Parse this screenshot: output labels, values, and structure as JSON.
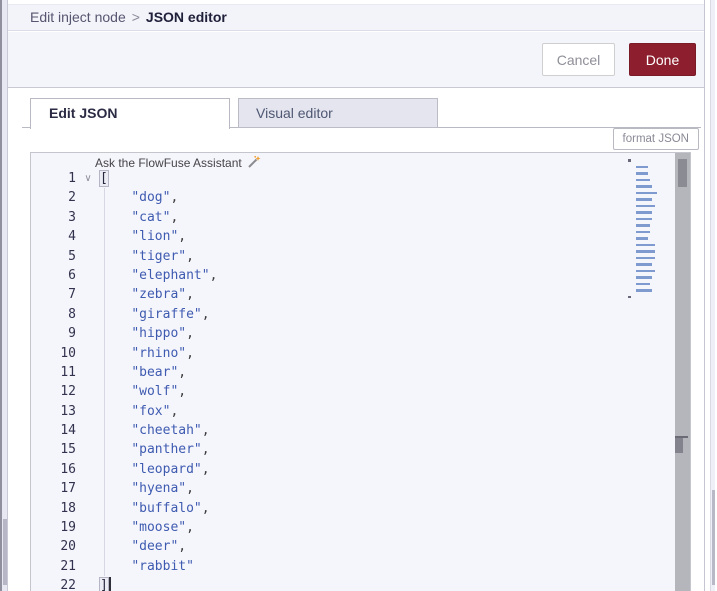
{
  "breadcrumb": {
    "parent": "Edit inject node",
    "separator": ">",
    "current": "JSON editor"
  },
  "buttons": {
    "cancel": "Cancel",
    "done": "Done",
    "format_json": "format JSON"
  },
  "tabs": [
    {
      "label": "Edit JSON",
      "active": true
    },
    {
      "label": "Visual editor",
      "active": false
    }
  ],
  "assistant": {
    "label": "Ask the FlowFuse Assistant",
    "icon": "pencil-sparkle-icon"
  },
  "editor": {
    "language": "json",
    "open_bracket": "[",
    "close_bracket": "]",
    "indent": "    ",
    "items": [
      "dog",
      "cat",
      "lion",
      "tiger",
      "elephant",
      "zebra",
      "giraffe",
      "hippo",
      "rhino",
      "bear",
      "wolf",
      "fox",
      "cheetah",
      "panther",
      "leopard",
      "hyena",
      "buffalo",
      "moose",
      "deer",
      "rabbit"
    ],
    "first_line_number": 1,
    "last_line_number": 22,
    "cursor_line": 22,
    "fold_icon": "chevron-down-icon"
  },
  "colors": {
    "done_button": "#8C1E2D",
    "string_token": "#3E5BB0",
    "line_number": "#32324E",
    "editor_background": "#F5F5FC",
    "inactive_tab_background": "#E5E5F0",
    "scrollbar_track": "#B5B5BC"
  }
}
